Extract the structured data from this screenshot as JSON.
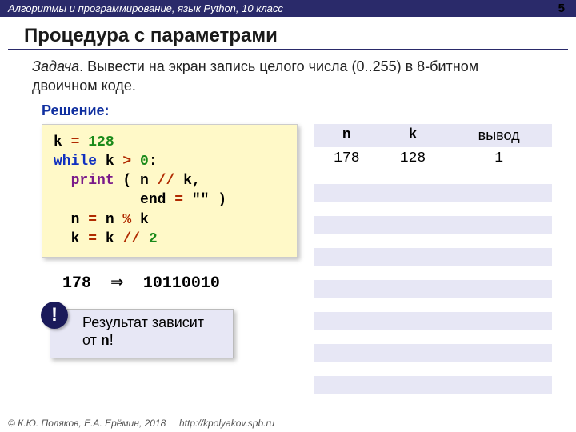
{
  "header": {
    "course": "Алгоритмы и программирование, язык Python, 10 класс",
    "page": "5"
  },
  "title": "Процедура с параметрами",
  "task": {
    "label": "Задача",
    "text": ". Вывести на экран запись целого числа (0..255) в 8-битном двоичном коде."
  },
  "solution_label": "Решение:",
  "code": {
    "l1a": "k",
    "l1b": " = ",
    "l1c": "128",
    "l2a": "while",
    "l2b": " k",
    "l2c": " > ",
    "l2d": "0",
    "l2e": ":",
    "l3a": "  ",
    "l3b": "print",
    "l3c": " ( n",
    "l3d": " // ",
    "l3e": "k,",
    "l4a": "          end",
    "l4b": " = ",
    "l4c": "\"\"",
    "l4d": " )",
    "l5a": "  n",
    "l5b": " = ",
    "l5c": "n",
    "l5d": " % ",
    "l5e": "k",
    "l6a": "  k",
    "l6b": " = ",
    "l6c": "k",
    "l6d": " // ",
    "l6e": "2"
  },
  "example": {
    "input": "178",
    "arrow": "⇒",
    "output": "10110010"
  },
  "note": {
    "text_a": "Результат зависит от ",
    "var": "n",
    "text_b": "!",
    "mark": "!"
  },
  "trace": {
    "headers": [
      "n",
      "k",
      "вывод"
    ],
    "row": [
      "178",
      "128",
      "1"
    ]
  },
  "footer": {
    "copyright": "© К.Ю. Поляков, Е.А. Ерёмин, 2018",
    "url": "http://kpolyakov.spb.ru"
  }
}
